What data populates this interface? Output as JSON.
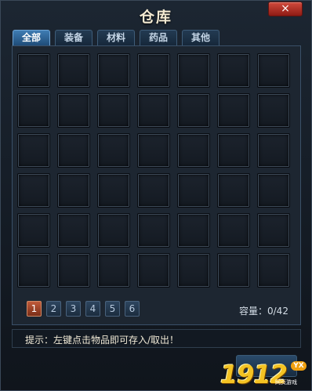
{
  "window": {
    "title": "仓库",
    "close_label": "×"
  },
  "tabs": [
    {
      "label": "全部",
      "active": true
    },
    {
      "label": "装备",
      "active": false
    },
    {
      "label": "材料",
      "active": false
    },
    {
      "label": "药品",
      "active": false
    },
    {
      "label": "其他",
      "active": false
    }
  ],
  "grid": {
    "rows": 6,
    "columns": 7,
    "items": []
  },
  "pagination": {
    "pages": [
      "1",
      "2",
      "3",
      "4",
      "5",
      "6"
    ],
    "current": "1"
  },
  "capacity": {
    "text": "容量：0/42"
  },
  "hint": {
    "text": "提示：左键点击物品即可存入/取出！"
  },
  "watermark": {
    "number": "1912",
    "badge": "YX",
    "subtitle": "网页游戏"
  },
  "colors": {
    "active_tab": "#3f7cb3",
    "active_page": "#c05a3a",
    "close_button": "#d14a3c",
    "logo": "#f3c323"
  }
}
